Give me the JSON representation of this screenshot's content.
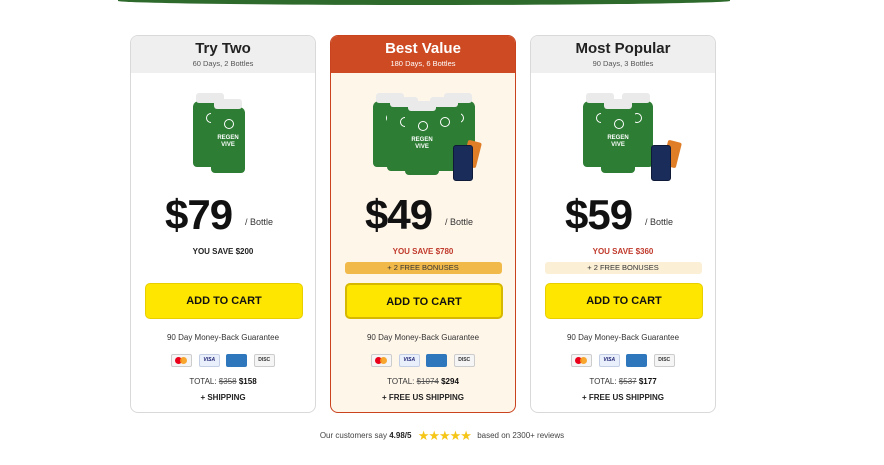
{
  "plans": [
    {
      "title": "Try Two",
      "subtitle": "60 Days, 2 Bottles",
      "price": "$79",
      "per": "/ Bottle",
      "savings": "YOU SAVE $200",
      "bonus": "",
      "cta": "ADD TO CART",
      "guarantee": "90 Day Money-Back Guarantee",
      "total_label": "TOTAL:",
      "total_old": "$358",
      "total_new": "$158",
      "shipping": "+ SHIPPING",
      "product_name": "REGEN VIVE"
    },
    {
      "title": "Best Value",
      "subtitle": "180 Days, 6 Bottles",
      "price": "$49",
      "per": "/ Bottle",
      "savings": "YOU SAVE $780",
      "bonus": "+ 2 FREE BONUSES",
      "cta": "ADD TO CART",
      "guarantee": "90 Day Money-Back Guarantee",
      "total_label": "TOTAL:",
      "total_old": "$1074",
      "total_new": "$294",
      "shipping": "+ FREE US SHIPPING",
      "product_name": "REGEN VIVE"
    },
    {
      "title": "Most Popular",
      "subtitle": "90 Days, 3 Bottles",
      "price": "$59",
      "per": "/ Bottle",
      "savings": "YOU SAVE $360",
      "bonus": "+ 2 FREE BONUSES",
      "cta": "ADD TO CART",
      "guarantee": "90 Day Money-Back Guarantee",
      "total_label": "TOTAL:",
      "total_old": "$537",
      "total_new": "$177",
      "shipping": "+ FREE US SHIPPING",
      "product_name": "REGEN VIVE"
    }
  ],
  "payment_icons": [
    "mastercard-icon",
    "visa-icon",
    "amex-icon",
    "discover-icon"
  ],
  "payment_labels": {
    "visa": "VISA",
    "discover": "DISC"
  },
  "reviews": {
    "prefix": "Our customers say",
    "rating": "4.98/5",
    "stars": "★★★★★",
    "suffix": "based on 2300+ reviews"
  },
  "colors": {
    "accent_red": "#cd4a22",
    "cta_yellow": "#ffe600",
    "bottle_green": "#2d7d34",
    "top_band": "#2e6a2c"
  }
}
